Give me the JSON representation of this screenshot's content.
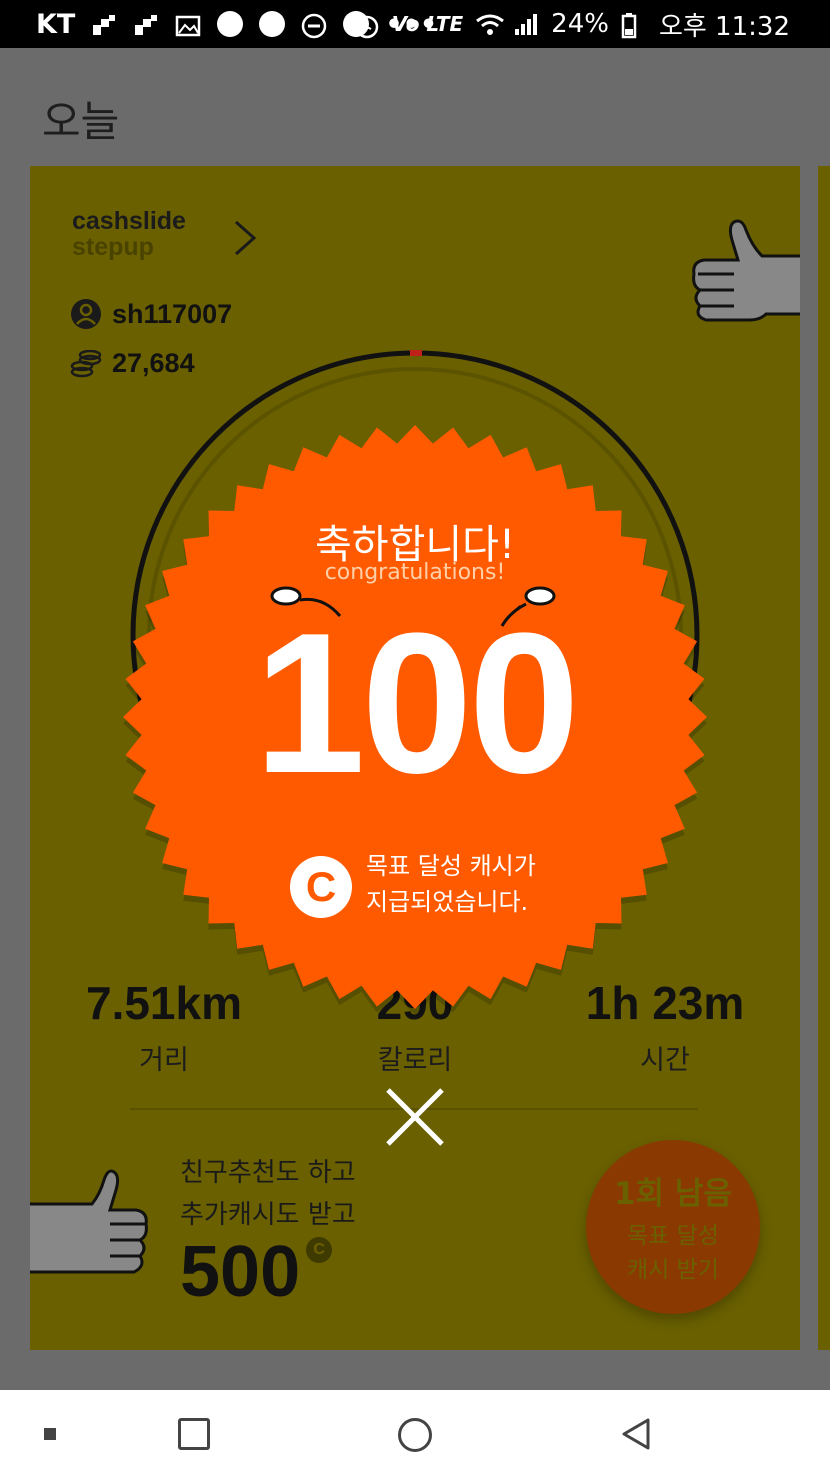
{
  "status_bar": {
    "carrier": "KT",
    "volte": "Vo LTE",
    "battery": "24%",
    "time": "오후 11:32"
  },
  "header": {
    "title": "오늘"
  },
  "card": {
    "logo_line1": "cashslide",
    "logo_line2": "stepup",
    "username": "sh117007",
    "coins": "27,684",
    "stats": [
      {
        "value": "7.51km",
        "label": "거리"
      },
      {
        "value": "290",
        "label": "칼로리"
      },
      {
        "value": "1h 23m",
        "label": "시간"
      }
    ],
    "promo": {
      "line1": "친구추천도 하고",
      "line2": "추가캐시도 받고",
      "amount": "500",
      "coin_symbol": "C"
    },
    "goal_button": {
      "remaining": "1회 남음",
      "line1": "목표 달성",
      "line2": "캐시 받기"
    }
  },
  "popup": {
    "title": "축하합니다!",
    "subtitle": "congratulations!",
    "amount": "100",
    "coin_symbol": "C",
    "message_line1": "목표 달성 캐시가",
    "message_line2": "지급되었습니다."
  },
  "colors": {
    "card_bg": "#6a6000",
    "popup_orange": "#ff5a00",
    "dim_overlay": "#6b6b6b",
    "navbar_bg": "#ffffff"
  }
}
